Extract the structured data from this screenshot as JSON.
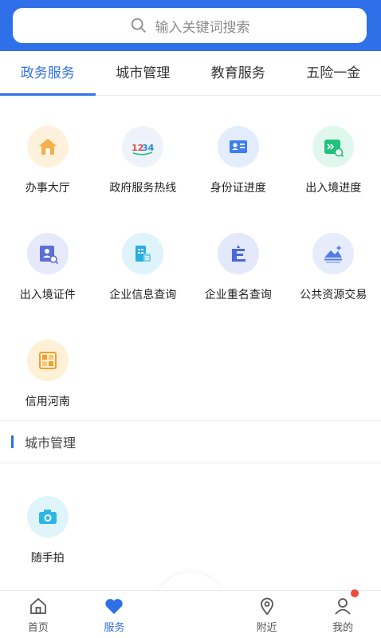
{
  "search": {
    "placeholder": "输入关键词搜索"
  },
  "tabs": [
    {
      "label": "政务服务"
    },
    {
      "label": "城市管理"
    },
    {
      "label": "教育服务"
    },
    {
      "label": "五险一金"
    }
  ],
  "services": [
    {
      "label": "办事大厅",
      "icon": "home-icon",
      "color": "#f6b04a",
      "bg": "#fff1db"
    },
    {
      "label": "政府服务热线",
      "icon": "hotline-12345-icon",
      "color": "#e64b3b",
      "bg": "#eef3fb"
    },
    {
      "label": "身份证进度",
      "icon": "id-card-icon",
      "color": "#3f7df0",
      "bg": "#e3edfd"
    },
    {
      "label": "出入境进度",
      "icon": "entry-exit-progress-icon",
      "color": "#23c07d",
      "bg": "#dff7ec"
    },
    {
      "label": "出入境证件",
      "icon": "entry-exit-document-icon",
      "color": "#5b6fd6",
      "bg": "#e6e9fa"
    },
    {
      "label": "企业信息查询",
      "icon": "enterprise-info-icon",
      "color": "#29aee0",
      "bg": "#def3fb"
    },
    {
      "label": "企业重名查询",
      "icon": "enterprise-name-icon",
      "color": "#4a68d8",
      "bg": "#e3e8fb"
    },
    {
      "label": "公共资源交易",
      "icon": "public-resource-icon",
      "color": "#5479e6",
      "bg": "#e6ecfb"
    },
    {
      "label": "信用河南",
      "icon": "credit-henan-icon",
      "color": "#f0a02e",
      "bg": "#fff0d8"
    }
  ],
  "city_section": {
    "title": "城市管理",
    "items": [
      {
        "label": "随手拍",
        "icon": "camera-icon",
        "color": "#2cb7e6",
        "bg": "#dff4fb"
      }
    ]
  },
  "nav": [
    {
      "label": "首页",
      "icon": "home-outline-icon"
    },
    {
      "label": "服务",
      "icon": "heart-icon"
    },
    {
      "label": "",
      "icon": "app-logo-icon"
    },
    {
      "label": "附近",
      "icon": "location-icon"
    },
    {
      "label": "我的",
      "icon": "user-icon"
    }
  ],
  "colors": {
    "accent": "#2f6fe8",
    "badge": "#f04a3a"
  }
}
